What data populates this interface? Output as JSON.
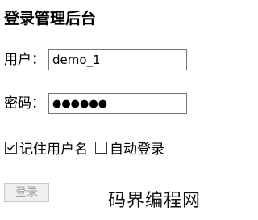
{
  "page": {
    "title": "登录管理后台"
  },
  "form": {
    "username_label": "用户：",
    "username_value": "demo_1",
    "password_label": "密码：",
    "password_value": "●●●●●●"
  },
  "options": {
    "remember_label": "记住用户名",
    "remember_checked": true,
    "auto_login_label": "自动登录",
    "auto_login_checked": false
  },
  "actions": {
    "login_label": "登录"
  },
  "watermark": {
    "text": "码界编程网"
  }
}
